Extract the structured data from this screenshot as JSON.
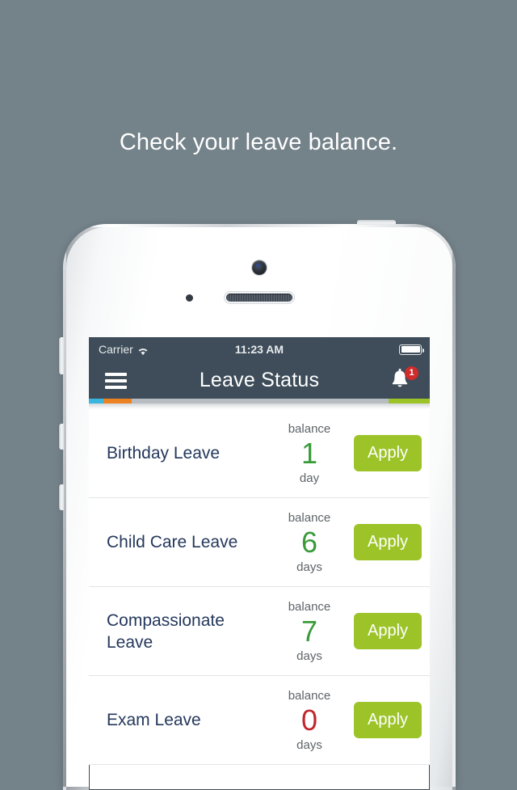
{
  "headline": "Check your leave balance.",
  "colors": {
    "page_background": "#74828a",
    "navbar": "#3e4d59",
    "accent_green": "#9cc428",
    "value_green": "#3a9b3a",
    "value_red": "#c0272d",
    "name_navy": "#24385c",
    "badge_red": "#d02c2c"
  },
  "status_bar": {
    "carrier": "Carrier",
    "wifi_icon": "wifi-icon",
    "time": "11:23 AM",
    "battery_icon": "battery-full-icon"
  },
  "navbar": {
    "menu_icon": "hamburger-menu-icon",
    "title": "Leave Status",
    "notification_icon": "bell-icon",
    "notification_count": "1"
  },
  "progress_bar": {
    "segments": [
      {
        "name": "cyan",
        "color": "#3ab5e0",
        "width_pct": 4.3
      },
      {
        "name": "orange",
        "color": "#ec8122",
        "width_pct": 8.3
      },
      {
        "name": "grey",
        "color": "#b6bcc1",
        "width_pct": 75.4
      },
      {
        "name": "green",
        "color": "#9cc428",
        "width_pct": 12.0
      }
    ]
  },
  "list": {
    "balance_label": "balance",
    "apply_label": "Apply",
    "rows": [
      {
        "name": "Birthday Leave",
        "balance": "1",
        "unit": "day",
        "value_color": "#3a9b3a",
        "action": "Apply"
      },
      {
        "name": "Child Care Leave",
        "balance": "6",
        "unit": "days",
        "value_color": "#3a9b3a",
        "action": "Apply"
      },
      {
        "name": "Compassionate Leave",
        "balance": "7",
        "unit": "days",
        "value_color": "#3a9b3a",
        "action": "Apply"
      },
      {
        "name": "Exam Leave",
        "balance": "0",
        "unit": "days",
        "value_color": "#c0272d",
        "action": "Apply"
      }
    ]
  },
  "device": {
    "camera_icon": "front-camera",
    "speaker_icon": "earpiece-speaker",
    "sensor_icon": "proximity-sensor",
    "buttons": [
      "mute-switch",
      "volume-up-button",
      "volume-down-button",
      "power-button"
    ]
  }
}
